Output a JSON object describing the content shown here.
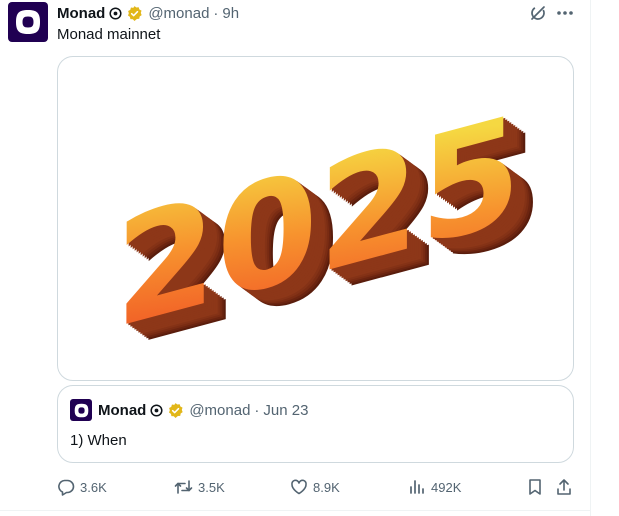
{
  "tweet": {
    "author_name": "Monad",
    "handle": "@monad",
    "separator": "·",
    "time": "9h",
    "text": "Monad mainnet",
    "image_text": "2025"
  },
  "quoted_tweet": {
    "author_name": "Monad",
    "handle": "@monad",
    "separator": "·",
    "time": "Jun 23",
    "text": "1) When"
  },
  "actions": {
    "replies": "3.6K",
    "reposts": "3.5K",
    "likes": "8.9K",
    "views": "492K"
  },
  "colors": {
    "brand": "#200052",
    "verified": "#e2b719",
    "muted_text": "#536471",
    "border": "#cfd9de"
  },
  "icons": [
    "monad-logo-icon",
    "affiliate-badge-icon",
    "verified-badge-icon",
    "grok-icon",
    "more-icon",
    "reply-icon",
    "repost-icon",
    "like-icon",
    "views-icon",
    "bookmark-icon",
    "share-icon"
  ]
}
